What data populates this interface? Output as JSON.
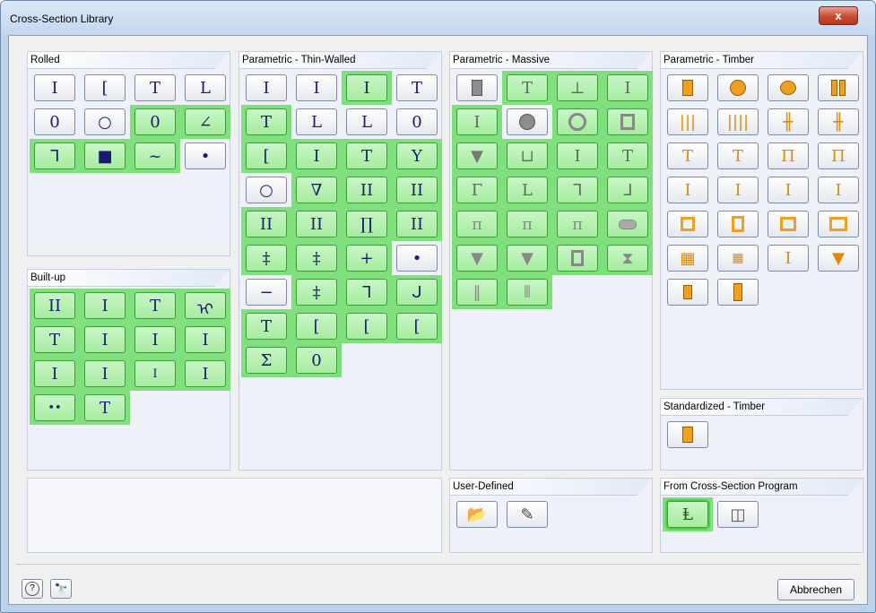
{
  "window": {
    "title": "Cross-Section Library",
    "close_glyph": "x"
  },
  "panels": {
    "rolled": {
      "title": "Rolled"
    },
    "built_up": {
      "title": "Built-up"
    },
    "thin_walled": {
      "title": "Parametric - Thin-Walled"
    },
    "massive": {
      "title": "Parametric - Massive"
    },
    "timber": {
      "title": "Parametric - Timber"
    },
    "std_timber": {
      "title": "Standardized - Timber"
    },
    "user_defined": {
      "title": "User-Defined"
    },
    "from_program": {
      "title": "From Cross-Section Program"
    }
  },
  "footer": {
    "cancel_label": "Abbrechen"
  },
  "glyphs": {
    "rolled": [
      "I",
      "[",
      "T",
      "L",
      "0",
      "○",
      "0",
      "∠",
      "ᒣ",
      "■",
      "~",
      "•"
    ],
    "built_up": [
      "II",
      "I",
      "T",
      "ᡳ",
      "T",
      "I",
      "I",
      "I",
      "I",
      "I",
      "I",
      "I",
      "••",
      "T"
    ],
    "thin_walled": [
      "I",
      "I",
      "I",
      "T",
      "T",
      "L",
      "L",
      "0",
      "[",
      "I",
      "T",
      "Y",
      "○",
      "∇",
      "II",
      "II",
      "II",
      "II",
      "∏",
      "II",
      "‡",
      "‡",
      "+",
      "•",
      "−",
      "‡",
      "ᒣ",
      "ᒍ",
      "T",
      "[",
      "[",
      "[",
      "Σ",
      "0"
    ]
  },
  "colors": {
    "active_cell": "#7fe07d",
    "timber_orange": "#f0a020",
    "massive_gray": "#8d8d8d"
  }
}
